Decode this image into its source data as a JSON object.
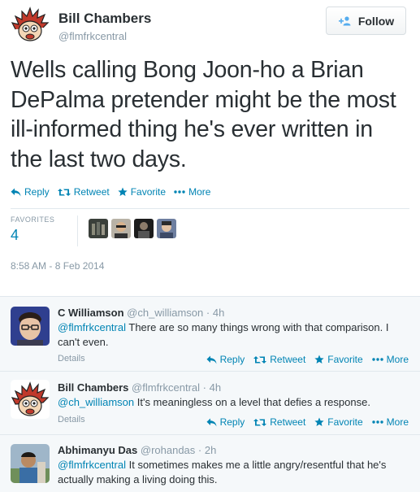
{
  "main_tweet": {
    "author_name": "Bill Chambers",
    "author_handle": "@flmfrkcentral",
    "follow_label": "Follow",
    "text": "Wells calling Bong Joon-ho a Brian DePalma pretender might be the most ill-informed thing he's ever written in the last two days.",
    "actions": {
      "reply": "Reply",
      "retweet": "Retweet",
      "favorite": "Favorite",
      "more": "More"
    },
    "favorites_label": "FAVORITES",
    "favorites_count": "4",
    "timestamp": "8:58 AM - 8 Feb 2014"
  },
  "replies": [
    {
      "name": "C Williamson",
      "handle": "@ch_williamson",
      "sep": "·",
      "time": "4h",
      "mention": "@flmfrkcentral",
      "text": " There are so many things wrong with that comparison. I can't even.",
      "details": "Details"
    },
    {
      "name": "Bill Chambers",
      "handle": "@flmfrkcentral",
      "sep": "·",
      "time": "4h",
      "mention": "@ch_williamson",
      "text": " It's meaningless on a level that defies a response.",
      "details": "Details"
    },
    {
      "name": "Abhimanyu Das",
      "handle": "@rohandas",
      "sep": "·",
      "time": "2h",
      "mention": "@flmfrkcentral",
      "text": " It sometimes makes me a little angry/resentful that he's actually making a living doing this."
    }
  ],
  "reply_actions": {
    "reply": "Reply",
    "retweet": "Retweet",
    "favorite": "Favorite",
    "more": "More"
  },
  "colors": {
    "link": "#0084b4",
    "muted": "#8899a6",
    "text": "#292f33",
    "reply_bg": "#f5f8fa"
  },
  "icons": [
    "reply-icon",
    "retweet-icon",
    "star-icon",
    "more-dots-icon",
    "add-user-icon"
  ]
}
